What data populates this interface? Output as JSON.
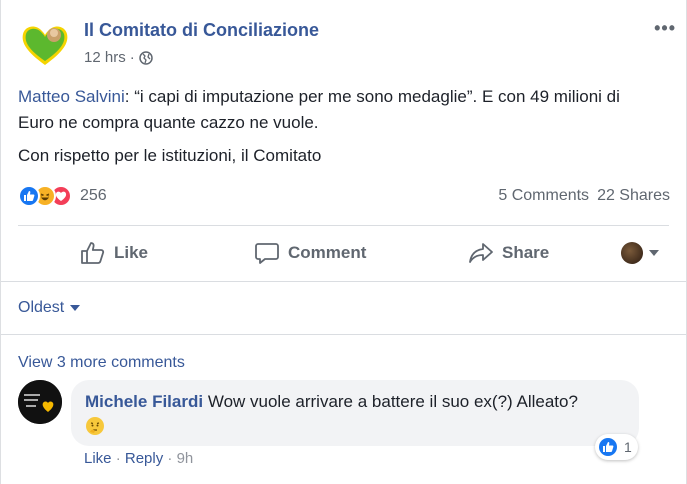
{
  "post": {
    "page_name": "Il Comitato di Conciliazione",
    "time": "12 hrs",
    "separator": "·",
    "mention": "Matteo Salvini",
    "text_rest": ": “i capi di imputazione per me sono medaglie”. E con 49 milioni di Euro ne compra quante cazzo ne vuole.",
    "text_line2": "Con rispetto per le istituzioni, il Comitato",
    "more_label": "•••"
  },
  "stats": {
    "reaction_count": "256",
    "comments": "5 Comments",
    "shares": "22 Shares"
  },
  "actions": {
    "like": "Like",
    "comment": "Comment",
    "share": "Share"
  },
  "sort": {
    "label": "Oldest"
  },
  "comments_section": {
    "view_more": "View 3 more comments",
    "comment": {
      "author": "Michele Filardi",
      "text": "Wow vuole arrivare a battere il suo ex(?) Alleato?",
      "like_count": "1",
      "like_label": "Like",
      "reply_label": "Reply",
      "dot": "·",
      "time": "9h"
    }
  },
  "colors": {
    "link": "#385898",
    "like_blue": "#1877f2",
    "haha_yellow": "#f7b125",
    "love_red": "#f33e58",
    "logo_green": "#5cb82e",
    "logo_yellow": "#f5d400"
  }
}
